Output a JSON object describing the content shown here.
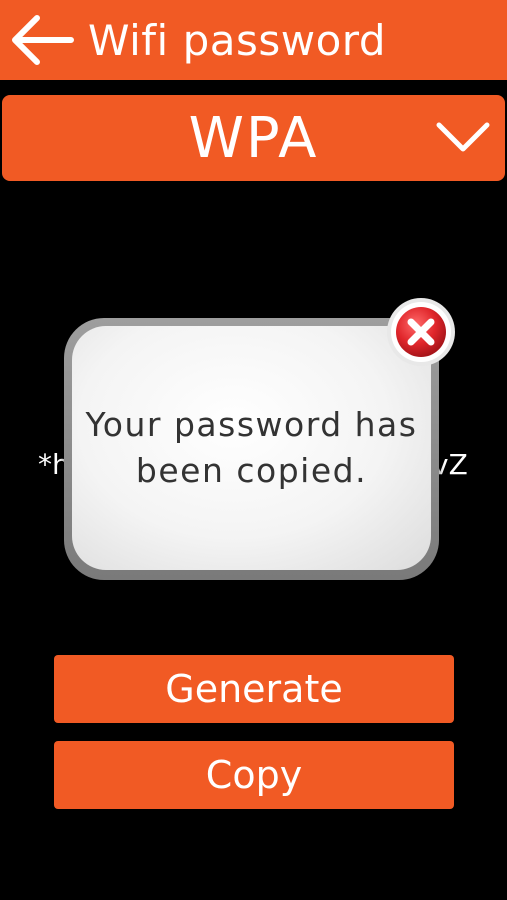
{
  "app_bar": {
    "title": "Wifi password",
    "back_icon": "arrow-left-icon"
  },
  "type_select": {
    "value": "WPA",
    "icon": "chevron-down-icon"
  },
  "password": {
    "left_fragment": "*h",
    "right_fragment": "vZ"
  },
  "buttons": {
    "generate_label": "Generate",
    "copy_label": "Copy"
  },
  "toast": {
    "message": "Your password has been copied.",
    "close_icon": "close-icon"
  },
  "colors": {
    "accent": "#F15A24",
    "background": "#000000",
    "close_red": "#E0262B"
  }
}
